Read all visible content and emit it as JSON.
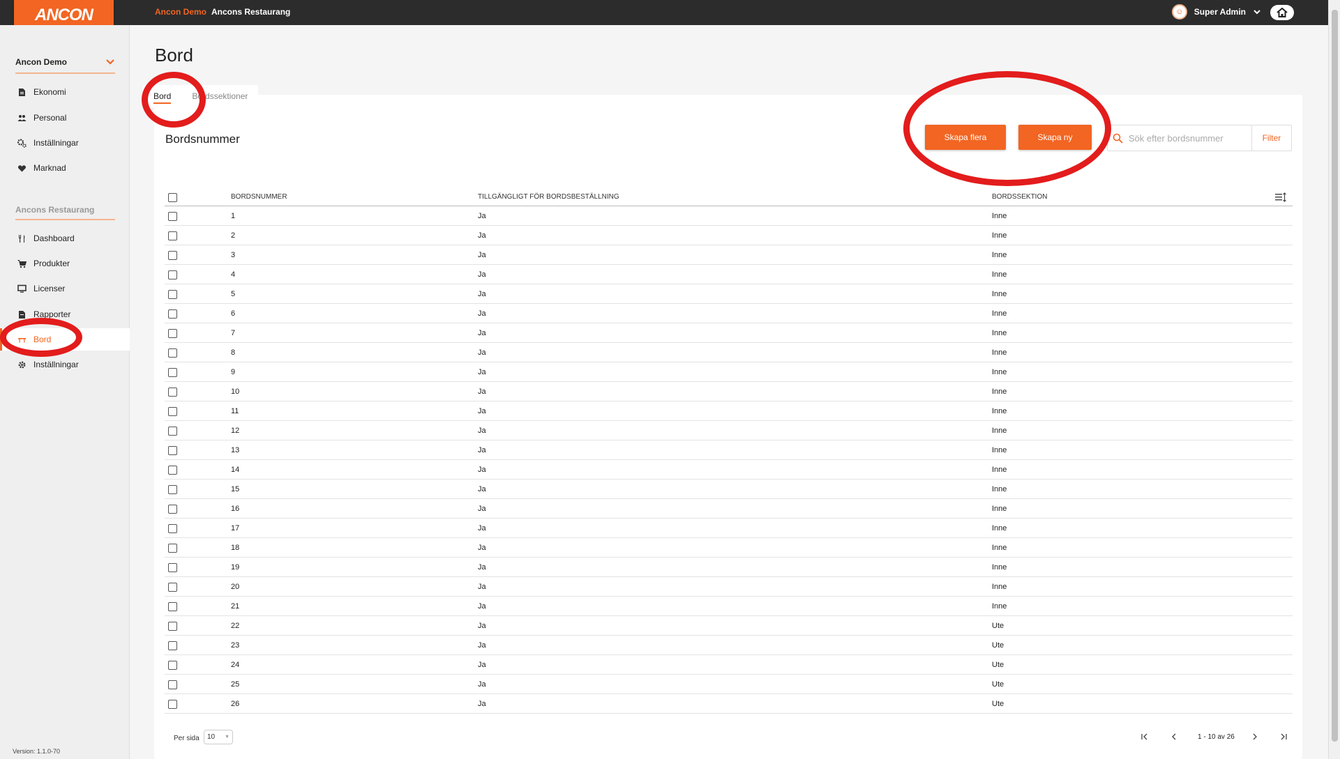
{
  "topbar": {
    "logo": "ANCON",
    "breadcrumb": [
      "Ancon Demo",
      "Ancons Restaurang"
    ],
    "user_name": "Super Admin"
  },
  "sidebar": {
    "org_name": "Ancon Demo",
    "group1": [
      "Ekonomi",
      "Personal",
      "Inställningar",
      "Marknad"
    ],
    "section_label": "Ancons Restaurang",
    "group2": [
      "Dashboard",
      "Produkter",
      "Licenser",
      "Rapporter",
      "Bord",
      "Inställningar"
    ],
    "version": "Version: 1.1.0-70"
  },
  "page": {
    "title": "Bord",
    "tabs": [
      "Bord",
      "Bordssektioner"
    ],
    "card_title": "Bordsnummer",
    "btn_create_many": "Skapa flera",
    "btn_create_new": "Skapa ny",
    "search_placeholder": "Sök efter bordsnummer",
    "filter_label": "Filter"
  },
  "table": {
    "columns": [
      "BORDSNUMMER",
      "TILLGÄNGLIGT FÖR BORDSBESTÄLLNING",
      "BORDSSEKTION"
    ],
    "rows": [
      [
        "1",
        "Ja",
        "Inne"
      ],
      [
        "2",
        "Ja",
        "Inne"
      ],
      [
        "3",
        "Ja",
        "Inne"
      ],
      [
        "4",
        "Ja",
        "Inne"
      ],
      [
        "5",
        "Ja",
        "Inne"
      ],
      [
        "6",
        "Ja",
        "Inne"
      ],
      [
        "7",
        "Ja",
        "Inne"
      ],
      [
        "8",
        "Ja",
        "Inne"
      ],
      [
        "9",
        "Ja",
        "Inne"
      ],
      [
        "10",
        "Ja",
        "Inne"
      ],
      [
        "11",
        "Ja",
        "Inne"
      ],
      [
        "12",
        "Ja",
        "Inne"
      ],
      [
        "13",
        "Ja",
        "Inne"
      ],
      [
        "14",
        "Ja",
        "Inne"
      ],
      [
        "15",
        "Ja",
        "Inne"
      ],
      [
        "16",
        "Ja",
        "Inne"
      ],
      [
        "17",
        "Ja",
        "Inne"
      ],
      [
        "18",
        "Ja",
        "Inne"
      ],
      [
        "19",
        "Ja",
        "Inne"
      ],
      [
        "20",
        "Ja",
        "Inne"
      ],
      [
        "21",
        "Ja",
        "Inne"
      ],
      [
        "22",
        "Ja",
        "Ute"
      ],
      [
        "23",
        "Ja",
        "Ute"
      ],
      [
        "24",
        "Ja",
        "Ute"
      ],
      [
        "25",
        "Ja",
        "Ute"
      ],
      [
        "26",
        "Ja",
        "Ute"
      ]
    ]
  },
  "pager": {
    "per_page_label": "Per sida",
    "per_page_value": "10",
    "range": "1 - 10 av 26"
  },
  "colors": {
    "accent": "#f26522",
    "annotation": "#e31c1c",
    "topbar": "#2c2c2c"
  }
}
